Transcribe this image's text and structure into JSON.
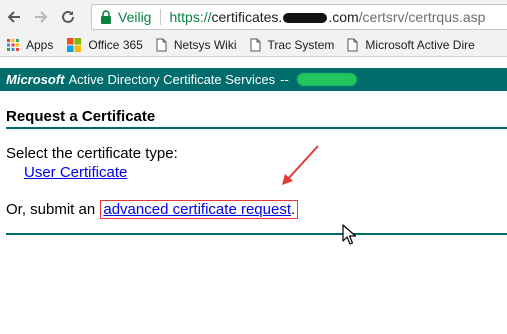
{
  "browser": {
    "secure_label": "Veilig",
    "url_scheme": "https://",
    "url_host_start": "certificates.",
    "url_host_end": ".com",
    "url_path": "/certsrv/certrqus.asp"
  },
  "bookmarks": [
    {
      "label": "Apps",
      "icon": "apps-grid-icon"
    },
    {
      "label": "Office 365",
      "icon": "office-logo-icon"
    },
    {
      "label": "Netsys Wiki",
      "icon": "page-icon"
    },
    {
      "label": "Trac System",
      "icon": "page-icon"
    },
    {
      "label": "Microsoft Active Dire",
      "icon": "page-icon"
    }
  ],
  "page": {
    "banner_brand": "Microsoft",
    "banner_title": "Active Directory Certificate Services",
    "banner_dash": "--",
    "heading": "Request a Certificate",
    "select_prompt": "Select the certificate type:",
    "user_cert_link": "User Certificate",
    "or_text": "Or, submit an",
    "advanced_link": "advanced certificate request",
    "period": "."
  },
  "colors": {
    "banner_bg": "#006c6c",
    "link": "#0000ee",
    "annotation": "#e53935",
    "secure": "#0b8043"
  }
}
